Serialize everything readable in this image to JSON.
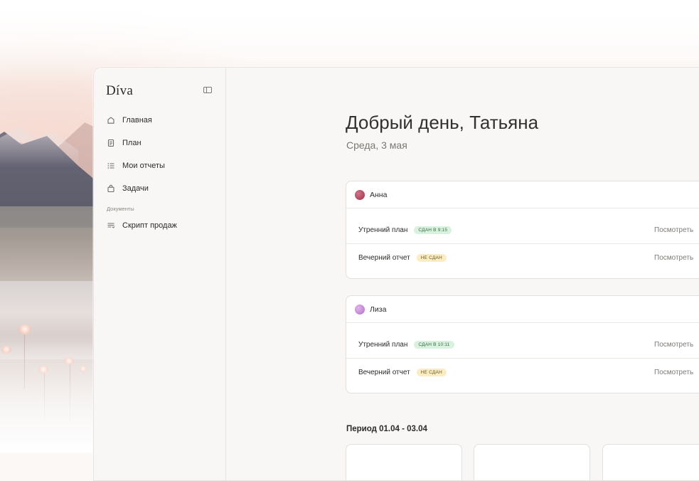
{
  "app": {
    "brand": "Díva"
  },
  "sidebar": {
    "items": [
      {
        "label": "Главная",
        "icon": "home-icon"
      },
      {
        "label": "План",
        "icon": "document-icon"
      },
      {
        "label": "Мои отчеты",
        "icon": "list-icon"
      },
      {
        "label": "Задачи",
        "icon": "bag-icon"
      }
    ],
    "section_label": "Документы",
    "documents": [
      {
        "label": "Скрипт продаж",
        "icon": "script-icon"
      }
    ]
  },
  "main": {
    "greeting": "Добрый день, Татьяна",
    "date": "Среда, 3 мая",
    "people": [
      {
        "name": "Анна",
        "avatar_color": "#b24d63",
        "rows": [
          {
            "label": "Утренний план",
            "status": "СДАН В 9:15",
            "status_type": "ok",
            "action": "Посмотреть"
          },
          {
            "label": "Вечерний отчет",
            "status": "НЕ СДАН",
            "status_type": "warn",
            "action": "Посмотреть"
          }
        ]
      },
      {
        "name": "Лиза",
        "avatar_color": "#c78ad6",
        "rows": [
          {
            "label": "Утренний план",
            "status": "СДАН В 10:11",
            "status_type": "ok",
            "action": "Посмотреть"
          },
          {
            "label": "Вечерний отчет",
            "status": "НЕ СДАН",
            "status_type": "warn",
            "action": "Посмотреть"
          }
        ]
      }
    ],
    "period_title": "Период 01.04 - 03.04"
  },
  "colors": {
    "ok_badge": "#d9f1df",
    "warn_badge": "#fbecc4",
    "sidebar_bg": "#f8f7f5"
  }
}
